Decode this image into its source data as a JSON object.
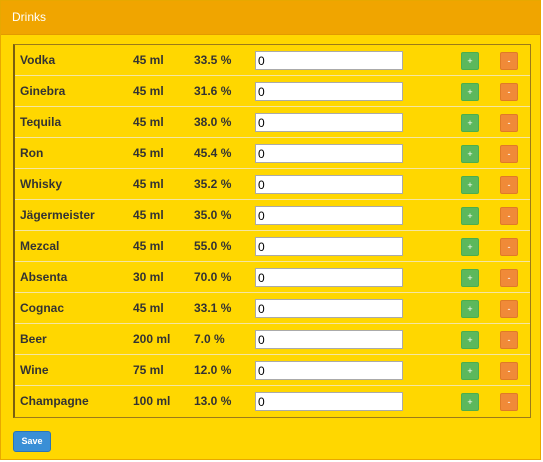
{
  "panel": {
    "title": "Drinks"
  },
  "drinks": [
    {
      "name": "Vodka",
      "volume": "45 ml",
      "abv": "33.5 %",
      "quantity": "0",
      "plus": "+",
      "minus": "-"
    },
    {
      "name": "Ginebra",
      "volume": "45 ml",
      "abv": "31.6 %",
      "quantity": "0",
      "plus": "+",
      "minus": "-"
    },
    {
      "name": "Tequila",
      "volume": "45 ml",
      "abv": "38.0 %",
      "quantity": "0",
      "plus": "+",
      "minus": "-"
    },
    {
      "name": "Ron",
      "volume": "45 ml",
      "abv": "45.4 %",
      "quantity": "0",
      "plus": "+",
      "minus": "-"
    },
    {
      "name": "Whisky",
      "volume": "45 ml",
      "abv": "35.2 %",
      "quantity": "0",
      "plus": "+",
      "minus": "-"
    },
    {
      "name": "Jägermeister",
      "volume": "45 ml",
      "abv": "35.0 %",
      "quantity": "0",
      "plus": "+",
      "minus": "-"
    },
    {
      "name": "Mezcal",
      "volume": "45 ml",
      "abv": "55.0 %",
      "quantity": "0",
      "plus": "+",
      "minus": "-"
    },
    {
      "name": "Absenta",
      "volume": "30 ml",
      "abv": "70.0 %",
      "quantity": "0",
      "plus": "+",
      "minus": "-"
    },
    {
      "name": "Cognac",
      "volume": "45 ml",
      "abv": "33.1 %",
      "quantity": "0",
      "plus": "+",
      "minus": "-"
    },
    {
      "name": "Beer",
      "volume": "200 ml",
      "abv": "7.0 %",
      "quantity": "0",
      "plus": "+",
      "minus": "-"
    },
    {
      "name": "Wine",
      "volume": "75 ml",
      "abv": "12.0 %",
      "quantity": "0",
      "plus": "+",
      "minus": "-"
    },
    {
      "name": "Champagne",
      "volume": "100 ml",
      "abv": "13.0 %",
      "quantity": "0",
      "plus": "+",
      "minus": "-"
    }
  ],
  "actions": {
    "save_label": "Save"
  },
  "colors": {
    "panel_background": "#ffd700",
    "header_background": "#f0a500",
    "plus_button": "#5cb85c",
    "minus_button": "#f08a38",
    "save_button": "#3a8fd6"
  }
}
